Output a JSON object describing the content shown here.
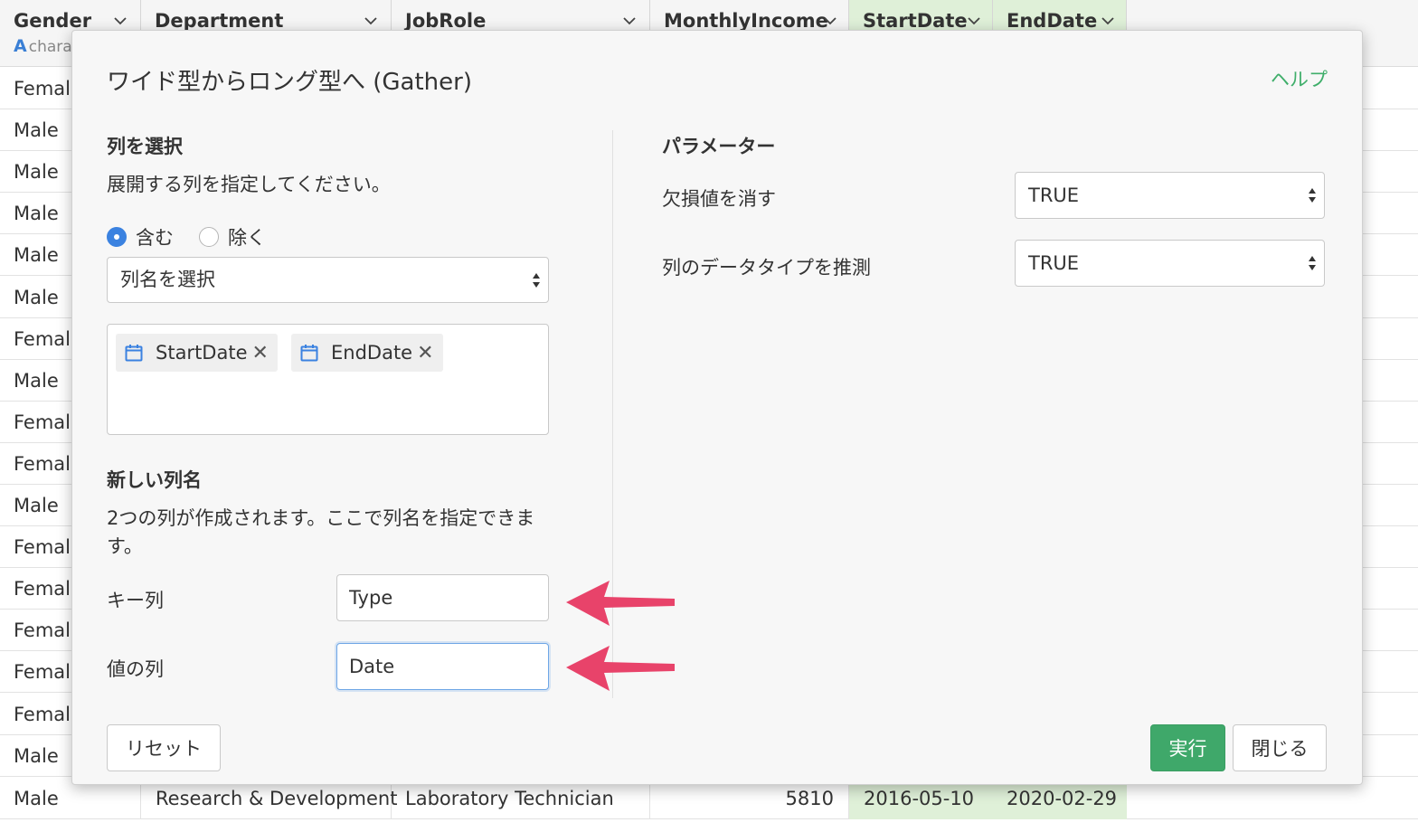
{
  "table": {
    "columns": [
      {
        "name": "Gender",
        "type_label": "chara"
      },
      {
        "name": "Department",
        "type_label": ""
      },
      {
        "name": "JobRole",
        "type_label": ""
      },
      {
        "name": "MonthlyIncome",
        "type_label": ""
      },
      {
        "name": "StartDate",
        "type_label": ""
      },
      {
        "name": "EndDate",
        "type_label": ""
      }
    ],
    "type_badge": "A",
    "gender_rows": [
      "Female",
      "Male",
      "Male",
      "Male",
      "Male",
      "Male",
      "Female",
      "Male",
      "Female",
      "Female",
      "Male",
      "Female",
      "Female",
      "Female",
      "Female",
      "Female",
      "Male"
    ],
    "last_row": {
      "gender": "Male",
      "department": "Research & Development",
      "job_role": "Laboratory Technician",
      "monthly_income": "5810",
      "start_date": "2016-05-10",
      "end_date": "2020-02-29"
    },
    "highlight_color": "#dff0d8"
  },
  "dialog": {
    "title": "ワイド型からロング型へ (Gather)",
    "help": "ヘルプ",
    "select_columns": {
      "title": "列を選択",
      "description": "展開する列を指定してください。",
      "radio_include": "含む",
      "radio_exclude": "除く",
      "select_placeholder": "列名を選択",
      "chips": [
        "StartDate",
        "EndDate"
      ]
    },
    "new_columns": {
      "title": "新しい列名",
      "description": "2つの列が作成されます。ここで列名を指定できます。",
      "key_label": "キー列",
      "key_value": "Type",
      "value_label": "値の列",
      "value_value": "Date"
    },
    "parameters": {
      "title": "パラメーター",
      "drop_na_label": "欠損値を消す",
      "drop_na_value": "TRUE",
      "guess_type_label": "列のデータタイプを推測",
      "guess_type_value": "TRUE"
    },
    "buttons": {
      "reset": "リセット",
      "run": "実行",
      "close": "閉じる"
    }
  },
  "colors": {
    "primary_button": "#3fa86a",
    "help_link": "#3fae6a",
    "radio_checked": "#3b82e0",
    "chip_icon": "#3b82e0",
    "annotation_arrow": "#e8436a"
  }
}
